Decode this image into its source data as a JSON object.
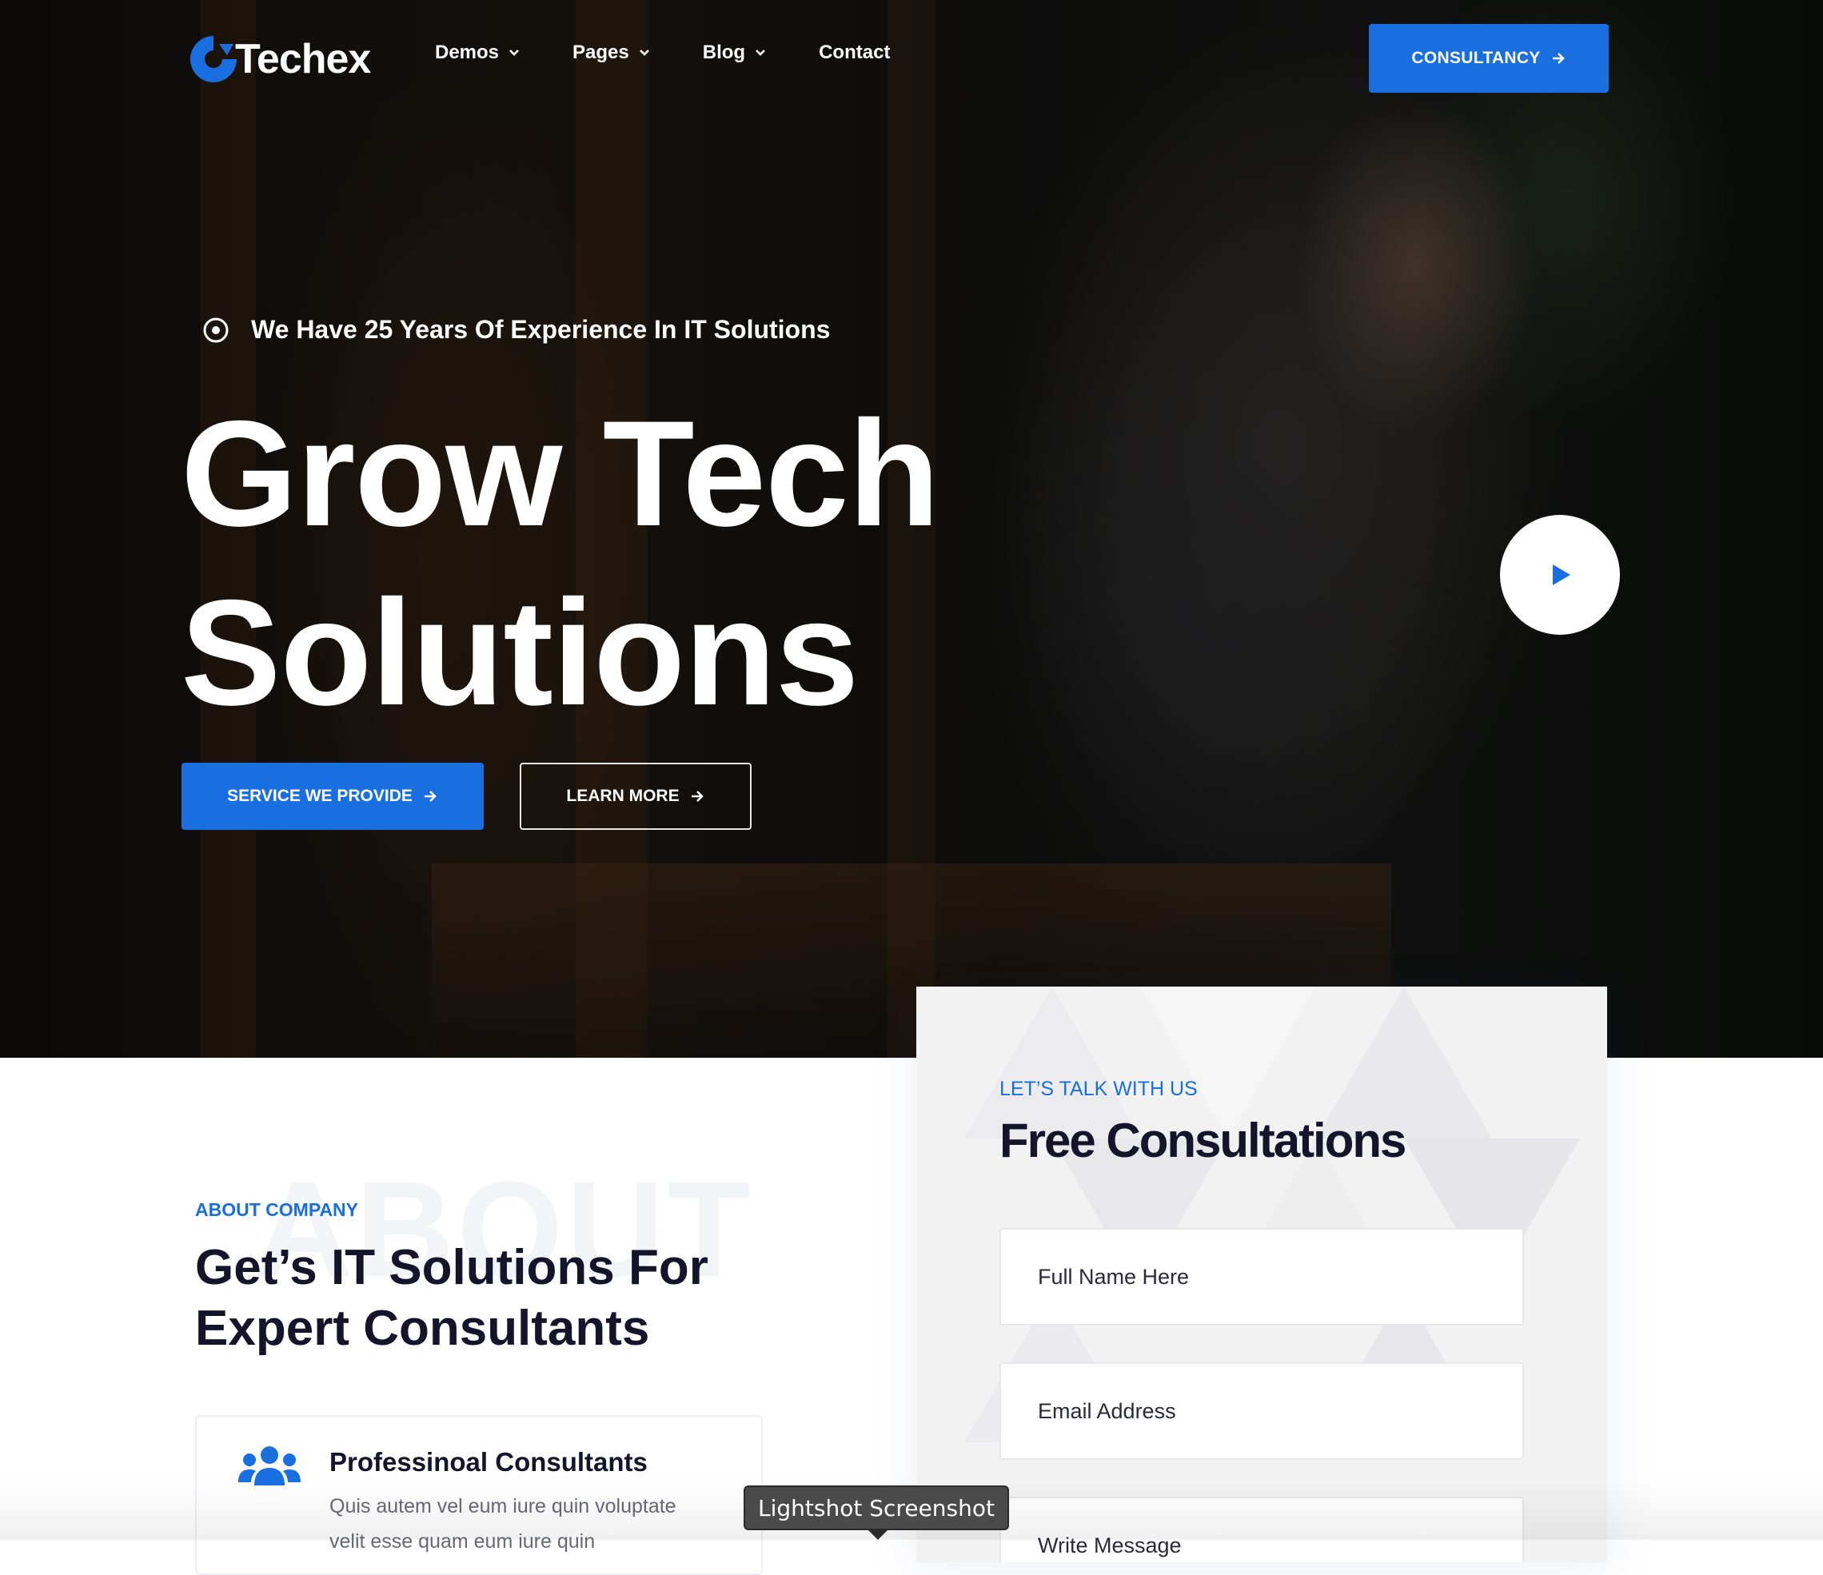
{
  "brand": {
    "name": "Techex",
    "accent_color": "#1a6fe0"
  },
  "nav": {
    "items": [
      {
        "label": "Demos",
        "has_dropdown": true
      },
      {
        "label": "Pages",
        "has_dropdown": true
      },
      {
        "label": "Blog",
        "has_dropdown": true
      },
      {
        "label": "Contact",
        "has_dropdown": false
      }
    ],
    "cta_label": "CONSULTANCY"
  },
  "hero": {
    "tagline": "We Have 25 Years Of Experience In IT Solutions",
    "headline_line1": "Grow Tech",
    "headline_line2": "Solutions",
    "primary_button": "SERVICE WE PROVIDE",
    "secondary_button": "LEARN MORE",
    "play_icon": "play-icon"
  },
  "about": {
    "ghost_text": "ABOUT",
    "label": "ABOUT COMPANY",
    "title": "Get’s IT Solutions For Expert Consultants",
    "feature": {
      "icon": "users-icon",
      "title": "Professinoal Consultants",
      "text": "Quis autem vel eum iure quin voluptate velit esse quam eum iure quin"
    }
  },
  "consultation": {
    "label": "LET’S TALK WITH US",
    "title": "Free Consultations",
    "fields": {
      "name_placeholder": "Full Name Here",
      "email_placeholder": "Email Address",
      "message_placeholder": "Write Message"
    }
  },
  "overlay": {
    "tooltip": "Lightshot Screenshot"
  }
}
